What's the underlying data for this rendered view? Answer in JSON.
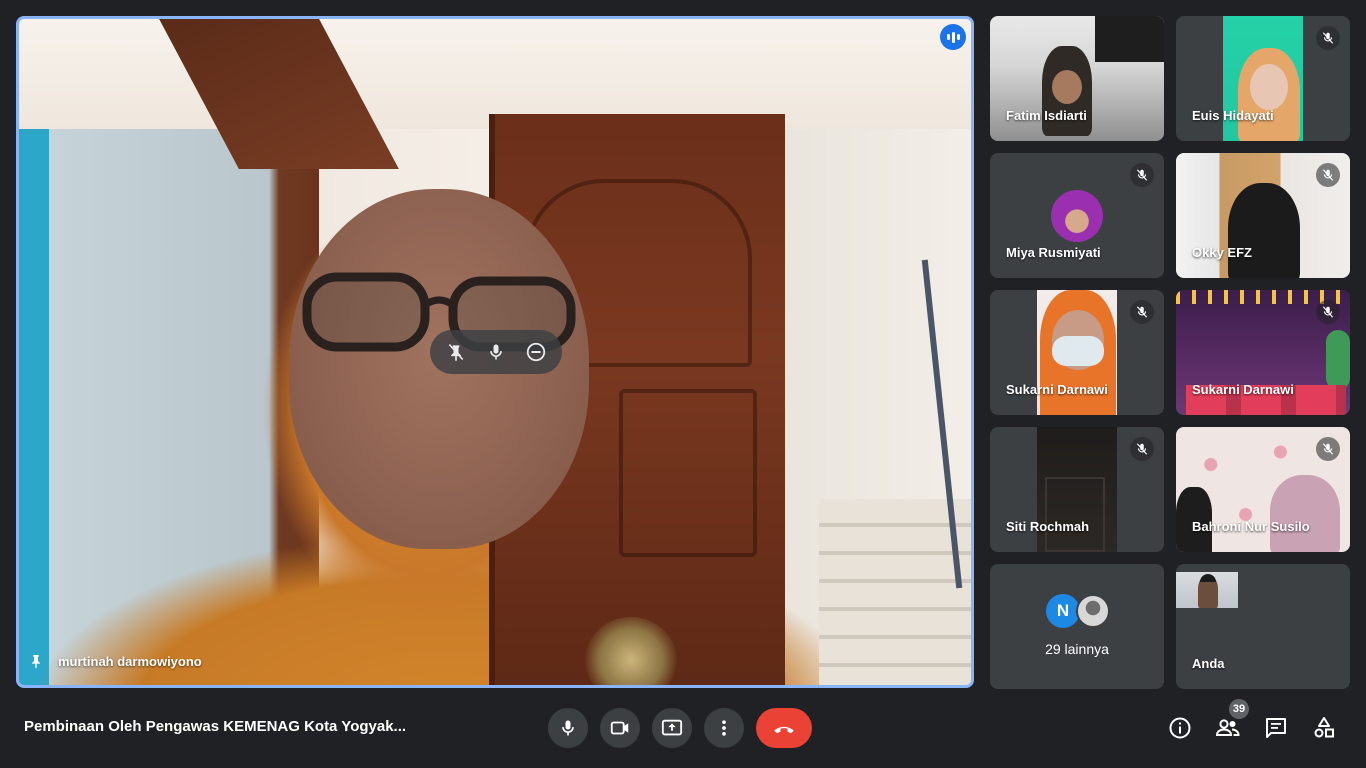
{
  "main_speaker": {
    "name": "murtinah darmowiyono"
  },
  "participants": [
    {
      "name": "Fatim Isdiarti",
      "muted": false
    },
    {
      "name": "Euis Hidayati",
      "muted": true
    },
    {
      "name": "Miya Rusmiyati",
      "muted": true
    },
    {
      "name": "Okky EFZ",
      "muted": true
    },
    {
      "name": "Sukarni Darnawi",
      "muted": true
    },
    {
      "name": "Sukarni Darnawi",
      "muted": true
    },
    {
      "name": "Siti Rochmah",
      "muted": true
    },
    {
      "name": "Bahroni Nur Susilo",
      "muted": true
    }
  ],
  "others_tile": {
    "initial": "N",
    "label": "29 lainnya"
  },
  "self_tile": {
    "name": "Anda"
  },
  "meeting": {
    "title": "Pembinaan Oleh Pengawas KEMENAG Kota Yogyak..."
  },
  "people_count": "39",
  "colors": {
    "background": "#202124",
    "tile": "#3c4043",
    "active_border": "#8ab4f8",
    "end_call": "#ea4335",
    "speaker_badge": "#1a73e8"
  },
  "icons": {
    "mic": "mic-icon",
    "camera": "camera-icon",
    "present": "present-screen-icon",
    "more": "more-vert-icon",
    "end_call": "end-call-icon",
    "info": "info-icon",
    "people": "people-icon",
    "chat": "chat-icon",
    "activities": "activities-icon"
  }
}
